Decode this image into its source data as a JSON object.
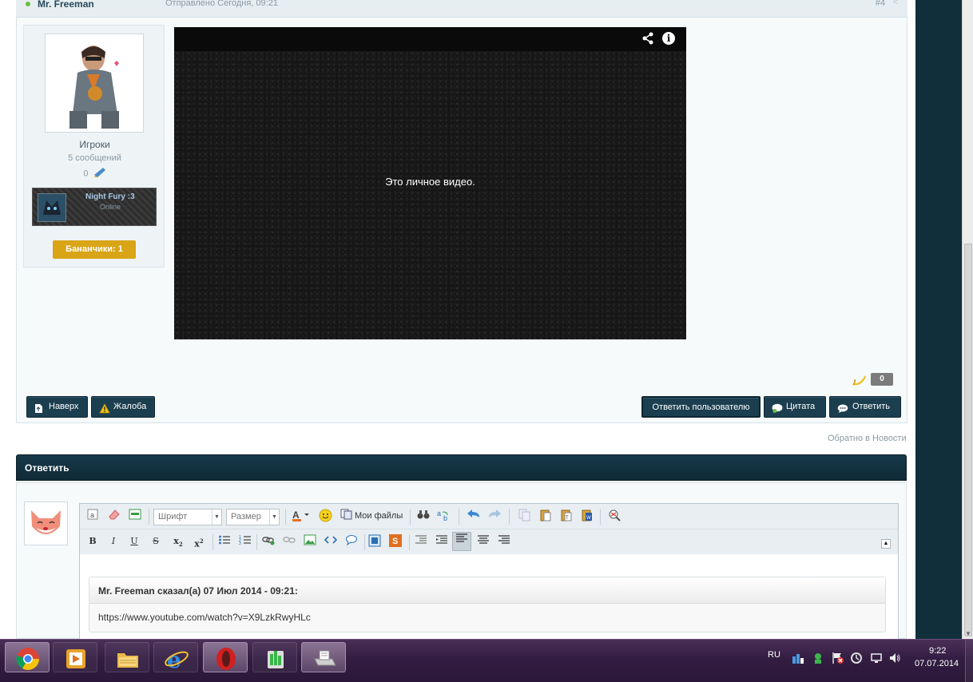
{
  "post": {
    "author": "Mr. Freeman",
    "date": "Отправлено Сегодня, 09:21",
    "number": "#4",
    "group": "Игроки",
    "post_count": "5 сообщений",
    "reputation": "0",
    "friend": {
      "name": "Night Fury :3",
      "status": "Online"
    },
    "bananas": "Бананчики: 1",
    "video_message": "Это личное видео.",
    "likes": "0",
    "buttons": {
      "top": "Наверх",
      "complaint": "Жалоба",
      "reply_user": "Ответить пользователю",
      "quote": "Цитата",
      "reply": "Ответить"
    },
    "back_link": "Обратно в Новости"
  },
  "reply": {
    "title": "Ответить",
    "toolbar": {
      "font_select": "Шрифт",
      "size_select": "Размер",
      "my_files": "Мои файлы"
    },
    "quote_header": "Mr. Freeman сказал(а) 07 Июл 2014 - 09:21:",
    "quote_text": "https://www.youtube.com/watch?v=X9LzkRwyHLc"
  },
  "taskbar": {
    "lang": "RU",
    "time": "9:22",
    "date": "07.07.2014",
    "apps": [
      "chrome-icon",
      "media-player-icon",
      "file-explorer-icon",
      "internet-explorer-icon",
      "opera-icon",
      "app-icon",
      "fax-icon"
    ]
  },
  "colors": {
    "header_dark": "#173949",
    "button_dark": "#1c3f50",
    "badge_gold": "#d9a516",
    "taskbar": "#331d42"
  }
}
